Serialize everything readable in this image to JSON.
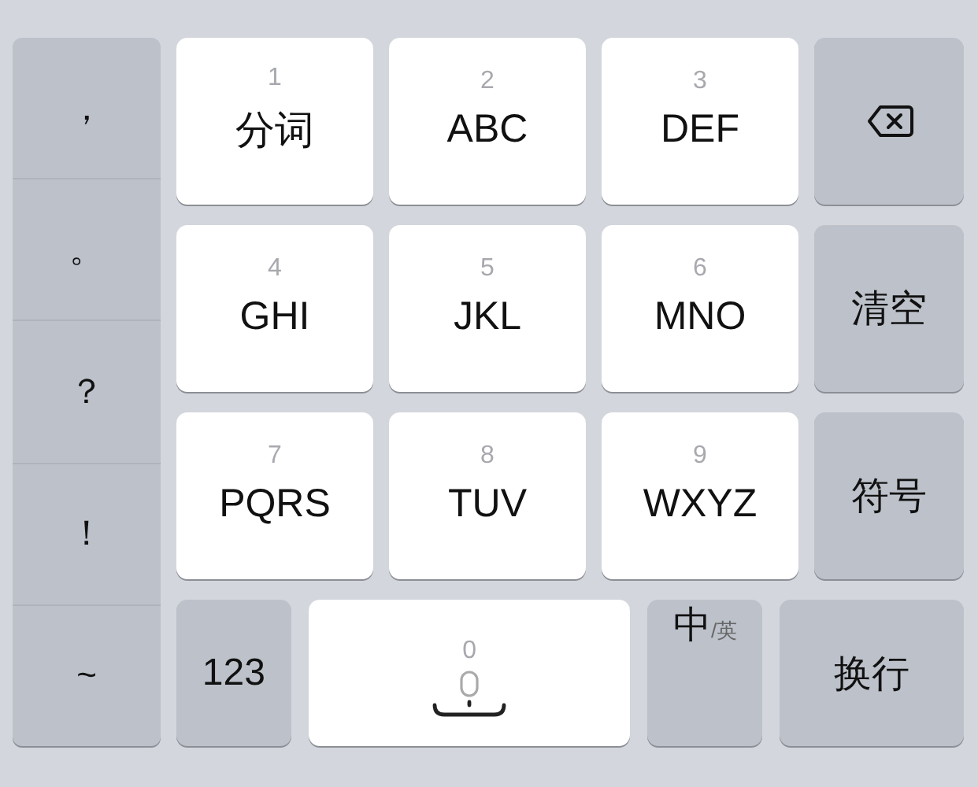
{
  "punctuation": [
    {
      "label": "，"
    },
    {
      "label": "。"
    },
    {
      "label": "？"
    },
    {
      "label": "！"
    },
    {
      "label": "~"
    }
  ],
  "letter_keys": [
    {
      "digit": "1",
      "label": "分词"
    },
    {
      "digit": "2",
      "label": "ABC"
    },
    {
      "digit": "3",
      "label": "DEF"
    },
    {
      "digit": "4",
      "label": "GHI"
    },
    {
      "digit": "5",
      "label": "JKL"
    },
    {
      "digit": "6",
      "label": "MNO"
    },
    {
      "digit": "7",
      "label": "PQRS"
    },
    {
      "digit": "8",
      "label": "TUV"
    },
    {
      "digit": "9",
      "label": "WXYZ"
    }
  ],
  "function_keys": [
    {
      "kind": "backspace"
    },
    {
      "kind": "text",
      "label": "清空"
    },
    {
      "kind": "text",
      "label": "符号"
    }
  ],
  "bottom_keys": [
    {
      "kind": "text",
      "label": "123"
    },
    {
      "kind": "space",
      "digit": "0"
    },
    {
      "kind": "toggle",
      "label": "中",
      "sub": "/英"
    },
    {
      "kind": "text",
      "label": "换行"
    }
  ]
}
